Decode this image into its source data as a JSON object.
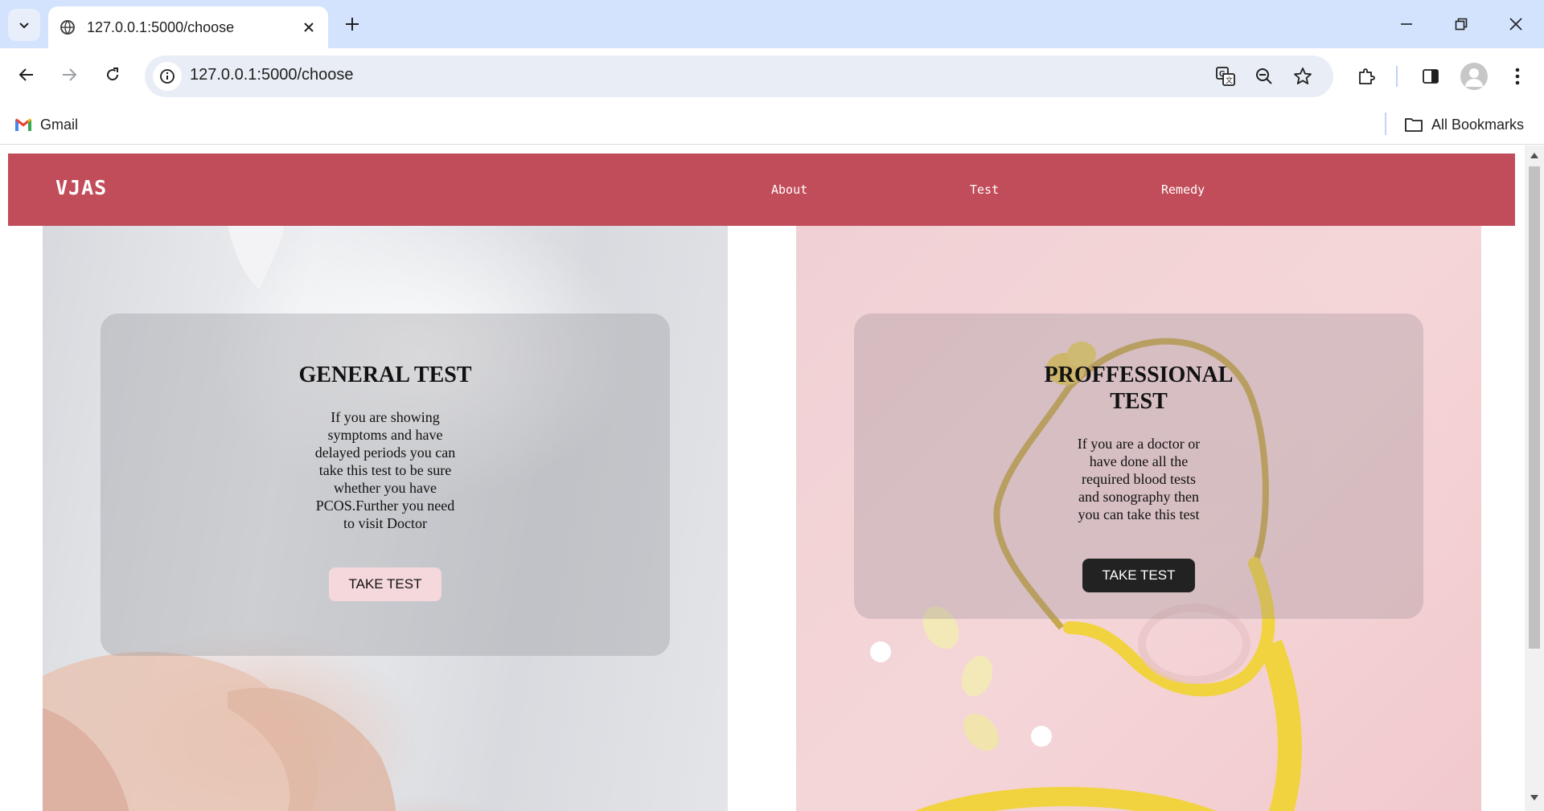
{
  "browser": {
    "tab_title": "127.0.0.1:5000/choose",
    "url": "127.0.0.1:5000/choose",
    "bookmarks": {
      "gmail": "Gmail",
      "all_bookmarks": "All Bookmarks"
    }
  },
  "site": {
    "logo": "VJAS",
    "nav": [
      "About",
      "Test",
      "Remedy"
    ],
    "brand_color": "#c24d5a"
  },
  "cards": {
    "general": {
      "title": "GENERAL TEST",
      "text": "If you are showing symptoms and have delayed periods you can take this test to be sure whether you have PCOS.Further you need to visit Doctor",
      "button": "TAKE TEST"
    },
    "professional": {
      "title": "PROFFESSIONAL TEST",
      "text": "If you are a doctor or have done all the required blood tests and sonography then you can take this test",
      "button": "TAKE TEST"
    }
  }
}
